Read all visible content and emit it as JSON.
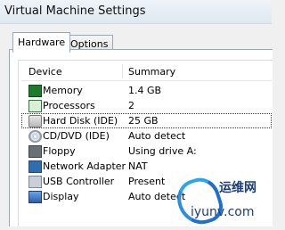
{
  "window": {
    "title": "Virtual Machine Settings"
  },
  "tabs": [
    {
      "label": "Hardware",
      "active": true
    },
    {
      "label": "Options",
      "active": false
    }
  ],
  "table": {
    "columns": [
      "Device",
      "Summary"
    ],
    "rows": [
      {
        "icon": "memory-chip-icon",
        "device": "Memory",
        "summary": "1.4 GB"
      },
      {
        "icon": "processor-icon",
        "device": "Processors",
        "summary": "2"
      },
      {
        "icon": "hard-disk-icon",
        "device": "Hard Disk (IDE)",
        "summary": "25 GB",
        "selected": true
      },
      {
        "icon": "cd-dvd-icon",
        "device": "CD/DVD (IDE)",
        "summary": "Auto detect"
      },
      {
        "icon": "floppy-icon",
        "device": "Floppy",
        "summary": "Using drive A:"
      },
      {
        "icon": "network-adapter-icon",
        "device": "Network Adapter",
        "summary": "NAT"
      },
      {
        "icon": "usb-controller-icon",
        "device": "USB Controller",
        "summary": "Present"
      },
      {
        "icon": "display-icon",
        "device": "Display",
        "summary": "Auto detect"
      }
    ]
  },
  "watermark": {
    "brand_cn": "运维网",
    "url": "iyunv.com"
  }
}
